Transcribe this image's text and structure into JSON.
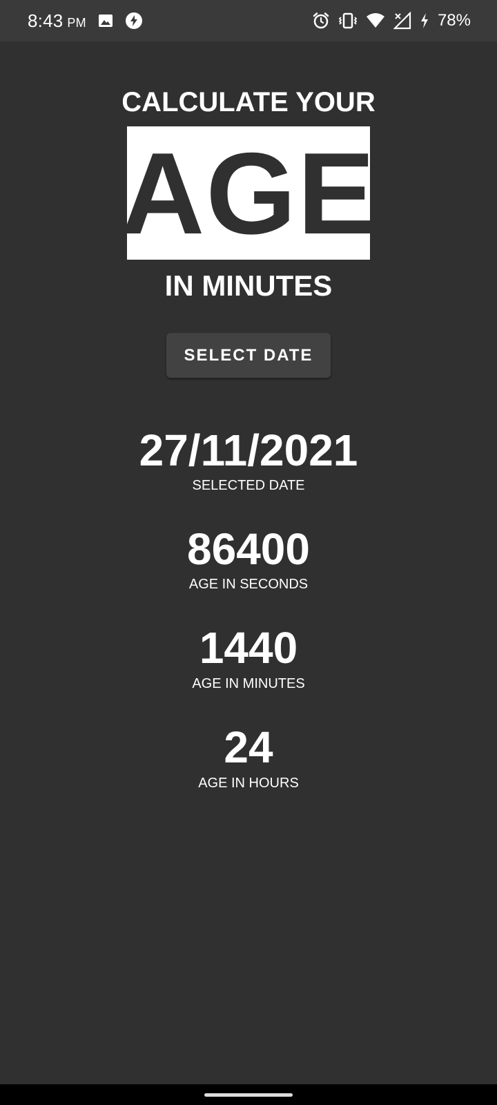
{
  "status_bar": {
    "time": "8:43",
    "ampm": "PM",
    "battery": "78%",
    "left_icons": [
      "image-icon",
      "bolt-circle-icon"
    ],
    "right_icons": [
      "alarm-icon",
      "vibrate-icon",
      "wifi-icon",
      "no-signal-icon",
      "charging-icon"
    ]
  },
  "header": {
    "line1": "CALCULATE YOUR",
    "highlight": "AGE",
    "line3": "IN MINUTES"
  },
  "button": {
    "label": "SELECT DATE"
  },
  "results": [
    {
      "value": "27/11/2021",
      "label": "SELECTED DATE"
    },
    {
      "value": "86400",
      "label": "AGE IN SECONDS"
    },
    {
      "value": "1440",
      "label": "AGE IN MINUTES"
    },
    {
      "value": "24",
      "label": "AGE IN HOURS"
    }
  ],
  "colors": {
    "background": "#303030",
    "status_bar": "#3a3a3a",
    "button": "#424242",
    "text": "#ffffff",
    "highlight_bg": "#ffffff"
  }
}
